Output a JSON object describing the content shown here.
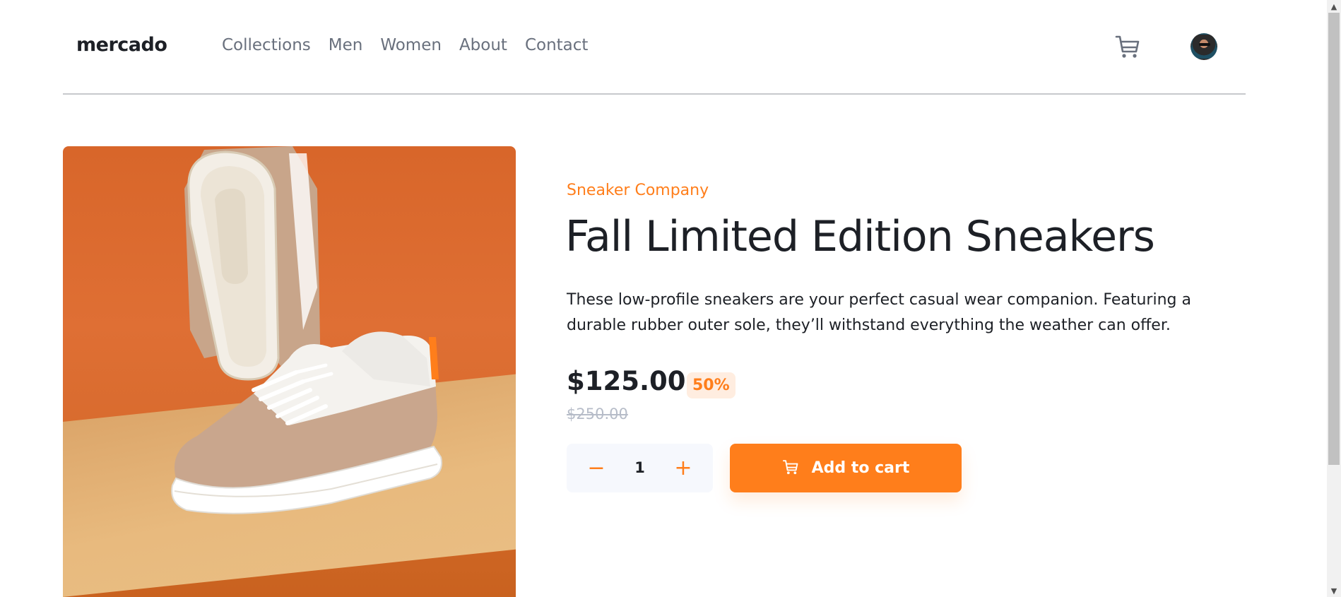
{
  "header": {
    "logo": "mercado",
    "nav": [
      "Collections",
      "Men",
      "Women",
      "About",
      "Contact"
    ],
    "cart_icon": "cart-icon",
    "avatar_icon": "avatar"
  },
  "product": {
    "company": "Sneaker Company",
    "title": "Fall Limited Edition Sneakers",
    "description": "These low-profile sneakers are your perfect casual wear companion. Featuring a durable rubber outer sole, they’ll withstand everything the weather can offer.",
    "price": "$125.00",
    "discount": "50%",
    "old_price": "$250.00",
    "quantity": "1",
    "minus_symbol": "−",
    "plus_symbol": "+",
    "add_to_cart": "Add to cart"
  },
  "colors": {
    "accent": "#ff7e1b",
    "accent_pale": "#ffede0",
    "text_dark": "#1d2026",
    "text_grey": "#69707d",
    "strike_grey": "#b6bcc8"
  },
  "scrollbar": {
    "up_arrow": "▲",
    "down_arrow": "▼"
  }
}
